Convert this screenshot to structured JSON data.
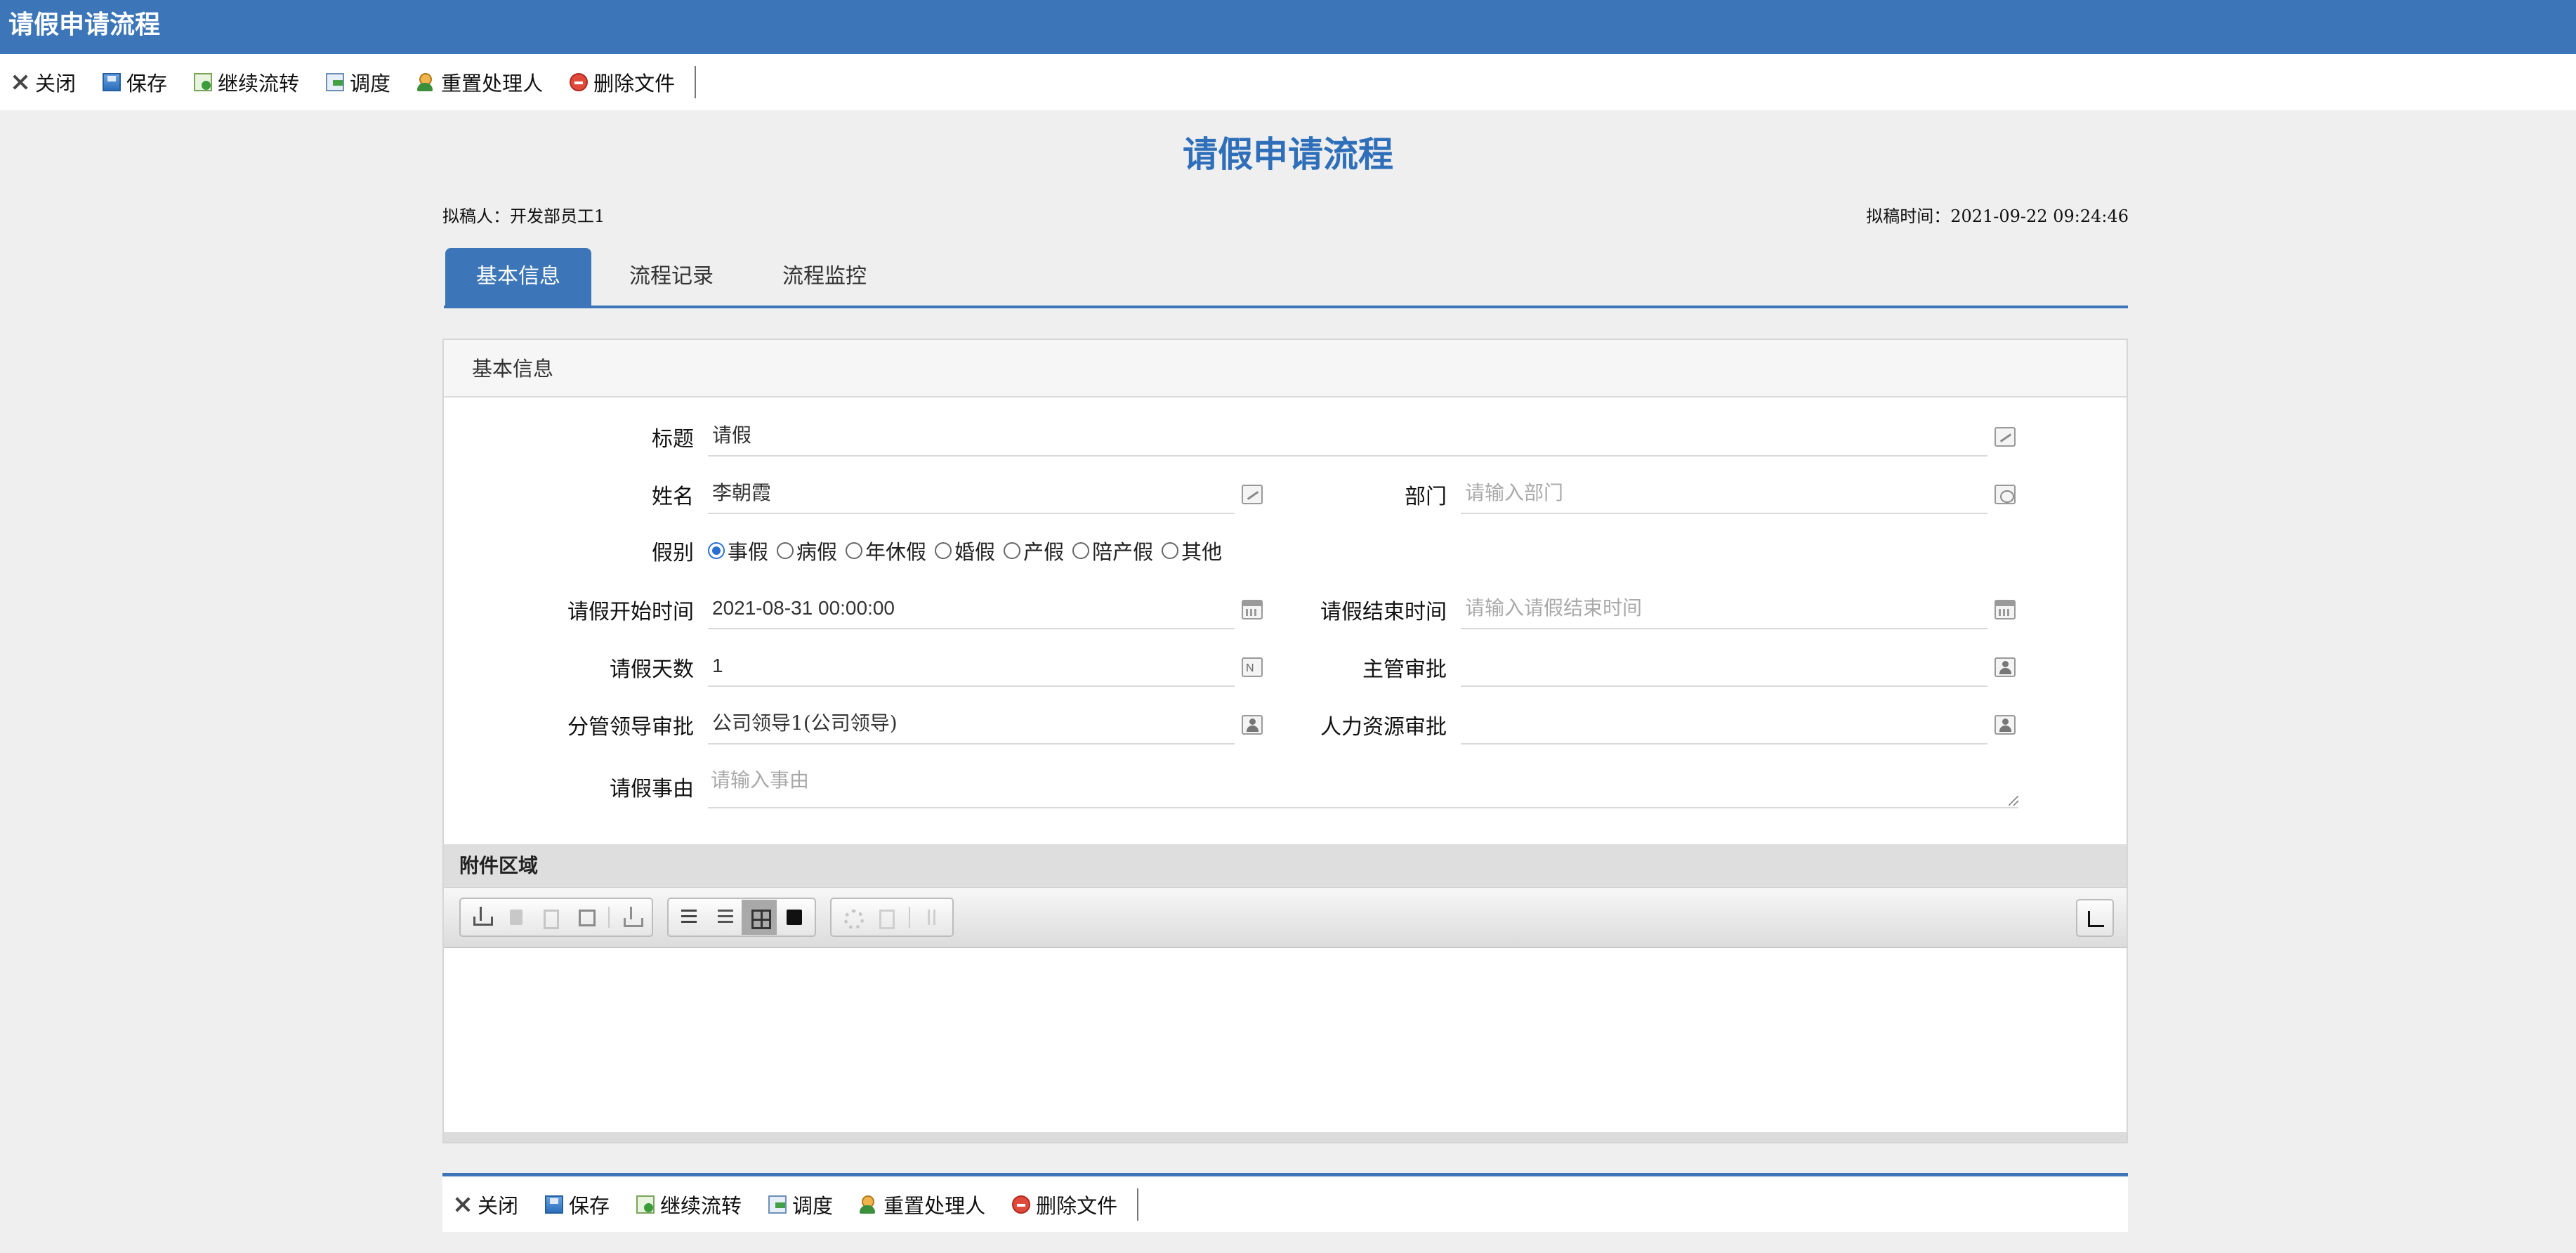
{
  "window": {
    "title": "请假申请流程"
  },
  "toolbar": {
    "items": [
      {
        "label": "关闭",
        "icon": "close-icon"
      },
      {
        "label": "保存",
        "icon": "save-icon"
      },
      {
        "label": "继续流转",
        "icon": "continue-flow-icon"
      },
      {
        "label": "调度",
        "icon": "dispatch-icon"
      },
      {
        "label": "重置处理人",
        "icon": "reset-handler-icon"
      },
      {
        "label": "删除文件",
        "icon": "delete-icon"
      }
    ]
  },
  "doc": {
    "title": "请假申请流程",
    "drafter_label": "拟稿人：",
    "drafter": "开发部员工1",
    "draft_time_label": "拟稿时间：",
    "draft_time": "2021-09-22 09:24:46"
  },
  "tabs": [
    {
      "label": "基本信息",
      "active": true
    },
    {
      "label": "流程记录",
      "active": false
    },
    {
      "label": "流程监控",
      "active": false
    }
  ],
  "panel": {
    "title": "基本信息",
    "fields": {
      "subject": {
        "label": "标题",
        "value": "请假"
      },
      "name": {
        "label": "姓名",
        "value": "李朝霞"
      },
      "department": {
        "label": "部门",
        "placeholder": "请输入部门"
      },
      "leave_type": {
        "label": "假别",
        "options": [
          "事假",
          "病假",
          "年休假",
          "婚假",
          "产假",
          "陪产假",
          "其他"
        ],
        "selected": "事假"
      },
      "start_time": {
        "label": "请假开始时间",
        "value": "2021-08-31 00:00:00"
      },
      "end_time": {
        "label": "请假结束时间",
        "placeholder": "请输入请假结束时间"
      },
      "days": {
        "label": "请假天数",
        "value": "1"
      },
      "supervisor": {
        "label": "主管审批",
        "value": ""
      },
      "leader": {
        "label": "分管领导审批",
        "value": "公司领导1(公司领导)"
      },
      "hr": {
        "label": "人力资源审批",
        "value": ""
      },
      "reason": {
        "label": "请假事由",
        "placeholder": "请输入事由"
      }
    }
  },
  "attachments": {
    "title": "附件区域"
  },
  "colors": {
    "brand": "#3c76b8",
    "title_text": "#2f6fba"
  }
}
